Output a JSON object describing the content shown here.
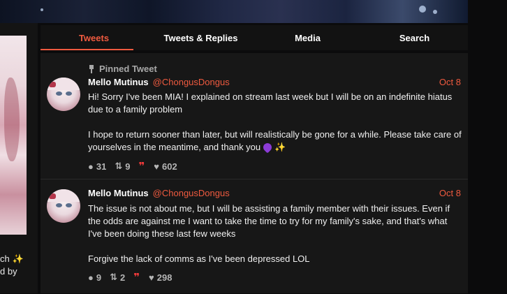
{
  "left": {
    "text_line1": "ch",
    "text_line2": "d by"
  },
  "tabs": [
    {
      "label": "Tweets"
    },
    {
      "label": "Tweets & Replies"
    },
    {
      "label": "Media"
    },
    {
      "label": "Search"
    }
  ],
  "tweets": [
    {
      "pinned_label": "Pinned Tweet",
      "display_name": "Mello Mutinus",
      "handle": "@ChongusDongus",
      "date": "Oct 8",
      "paragraphs": [
        "Hi!  Sorry I've been MIA!  I explained on stream last week but I will be on an indefinite hiatus due to a family problem",
        "I hope to return sooner than later, but will realistically be gone for a while. Please take care of yourselves in the meantime, and thank you"
      ],
      "replies": "31",
      "retweets": "9",
      "likes": "602"
    },
    {
      "display_name": "Mello Mutinus",
      "handle": "@ChongusDongus",
      "date": "Oct 8",
      "paragraphs": [
        "The issue is not about me, but I will be assisting a family member with their issues. Even if the odds are against me I want to take the time to try for my family's sake, and that's what I've been doing these last few weeks",
        "Forgive the lack of comms as I've been depressed LOL"
      ],
      "replies": "9",
      "retweets": "2",
      "likes": "298"
    }
  ],
  "colors": {
    "accent": "#ef5a3f",
    "background": "#171717",
    "quote": "#ef3a3a"
  },
  "icons": {
    "reply": "speech-bubble-icon",
    "retweet": "retweet-icon",
    "quote": "quote-icon",
    "like": "heart-icon",
    "pin": "pin-icon"
  }
}
